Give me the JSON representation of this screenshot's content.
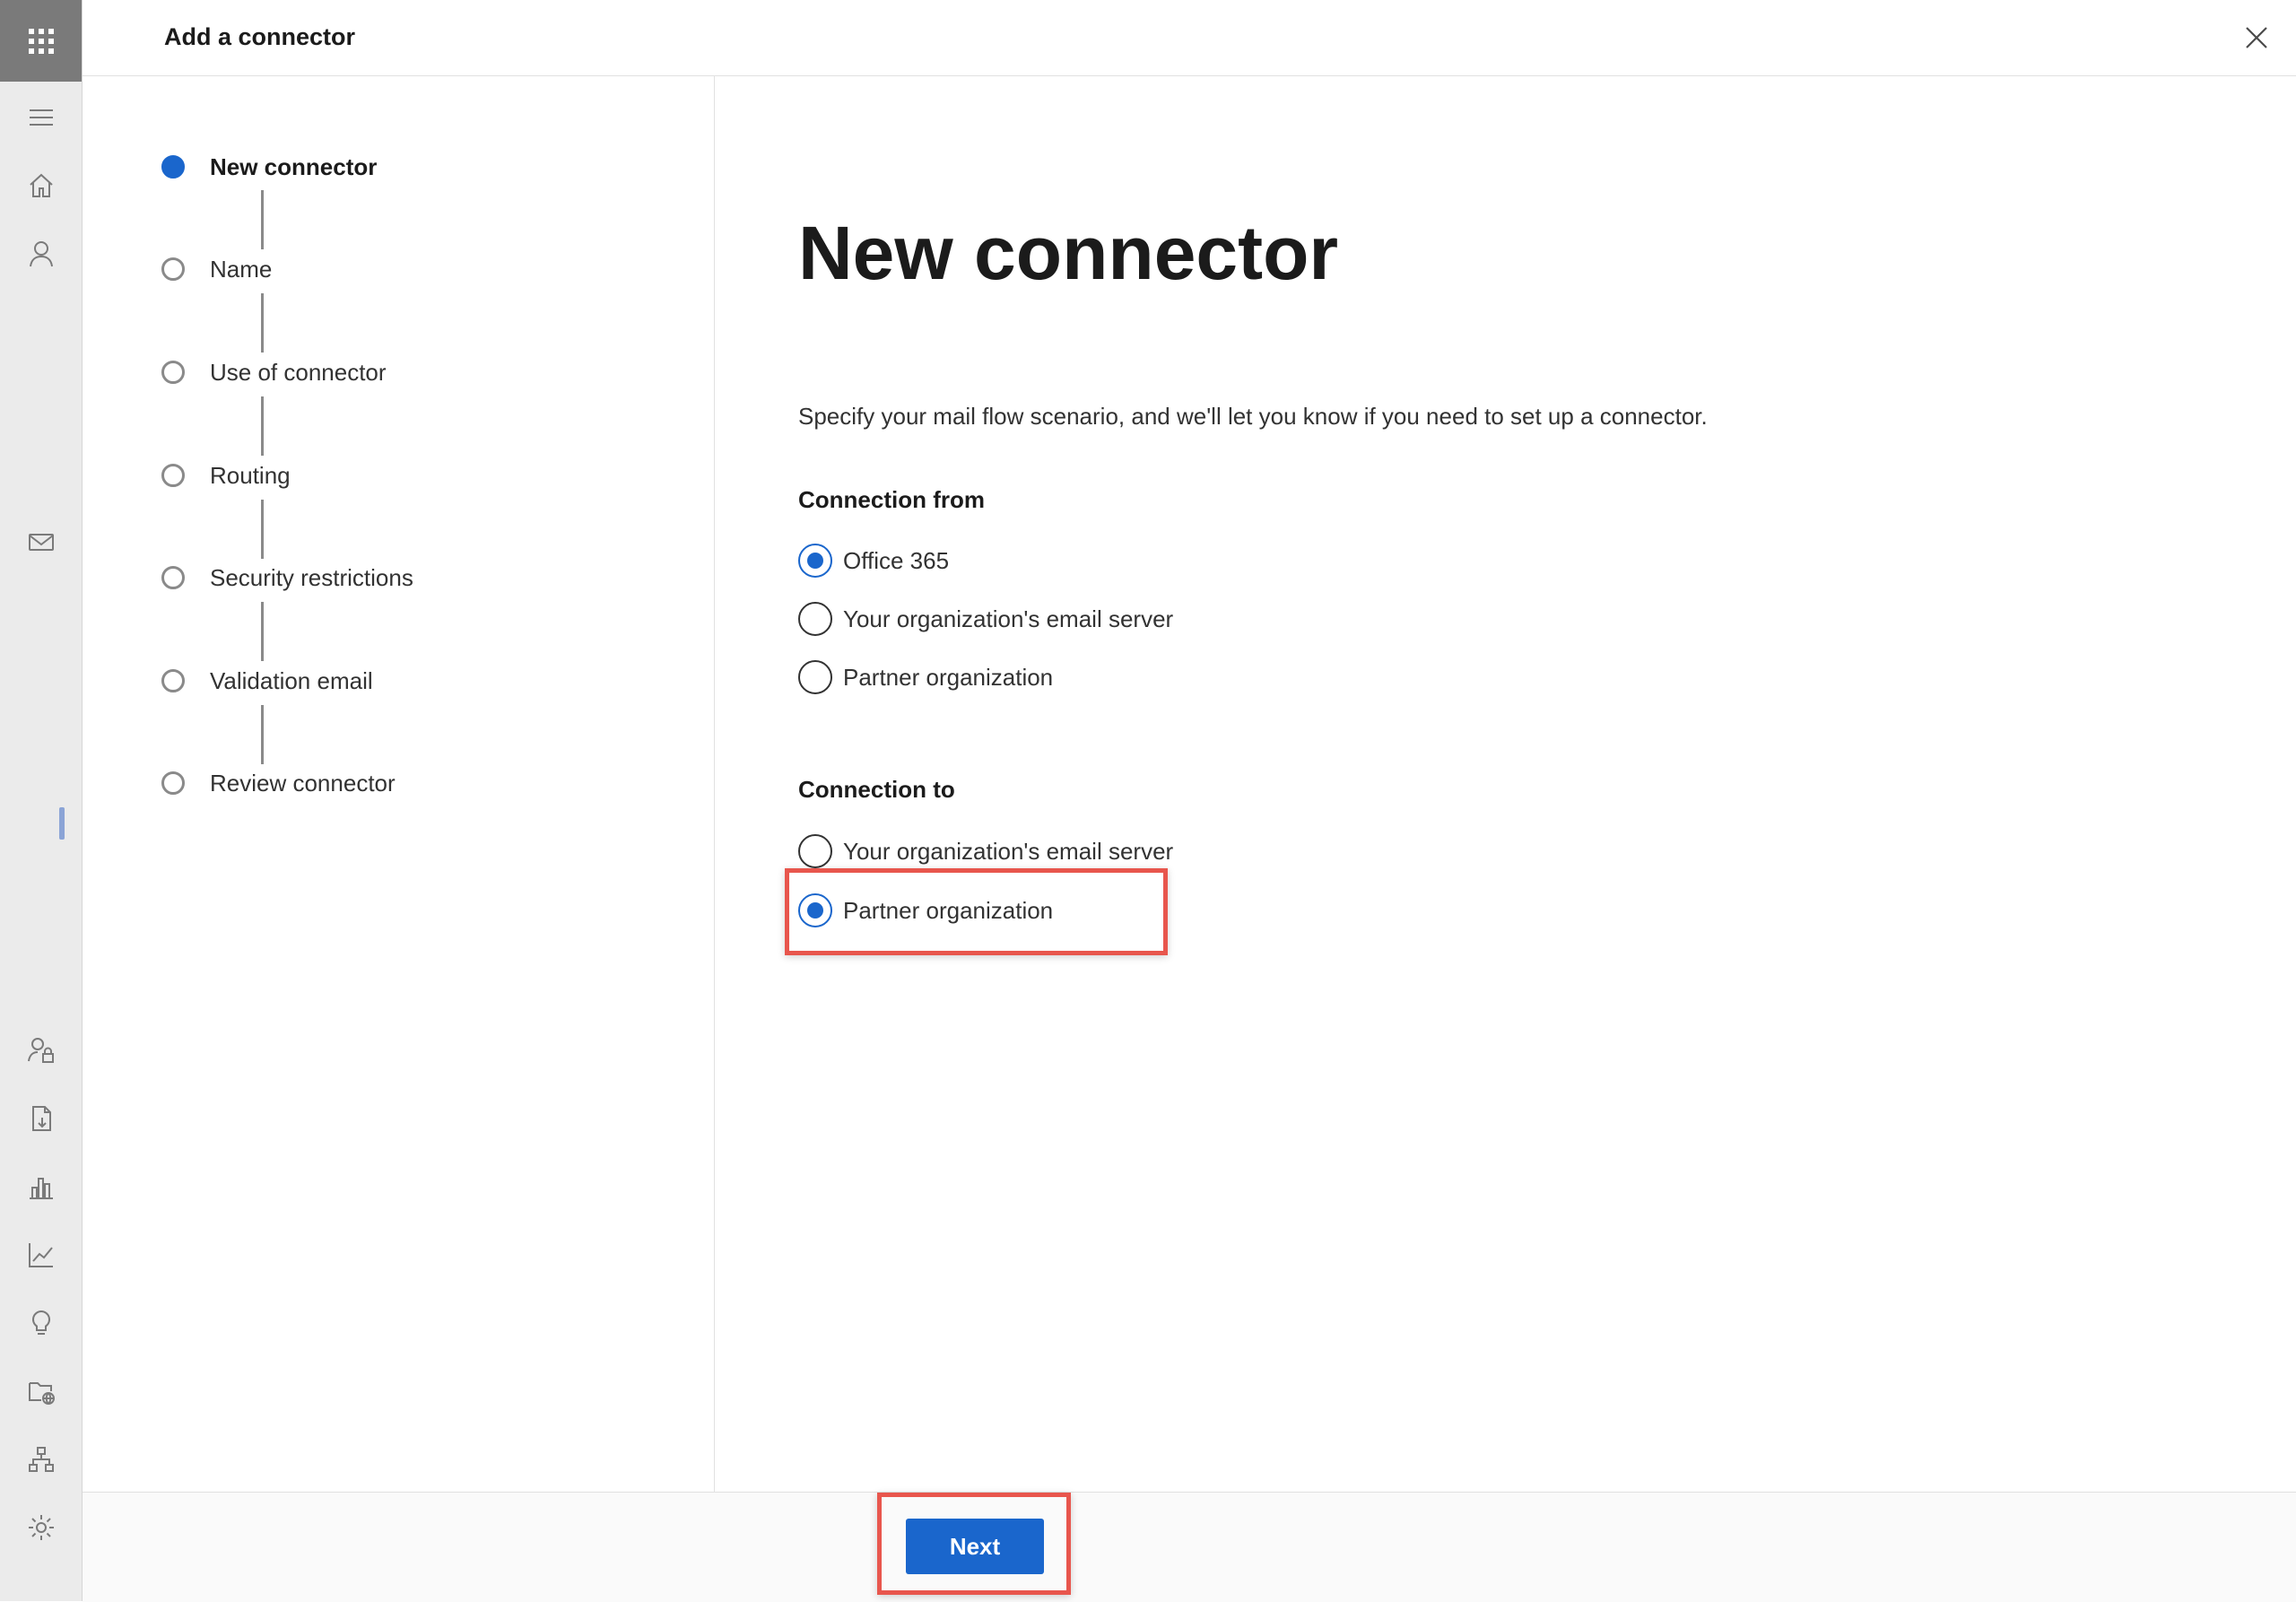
{
  "header": {
    "title": "Add a connector"
  },
  "steps": [
    {
      "label": "New connector",
      "state": "current"
    },
    {
      "label": "Name",
      "state": "pending"
    },
    {
      "label": "Use of connector",
      "state": "pending"
    },
    {
      "label": "Routing",
      "state": "pending"
    },
    {
      "label": "Security restrictions",
      "state": "pending"
    },
    {
      "label": "Validation email",
      "state": "pending"
    },
    {
      "label": "Review connector",
      "state": "pending"
    }
  ],
  "main": {
    "title": "New connector",
    "description": "Specify your mail flow scenario, and we'll let you know if you need to set up a connector.",
    "connection_from": {
      "label": "Connection from",
      "options": [
        "Office 365",
        "Your organization's email server",
        "Partner organization"
      ],
      "selected": "Office 365"
    },
    "connection_to": {
      "label": "Connection to",
      "options": [
        "Your organization's email server",
        "Partner organization"
      ],
      "selected": "Partner organization"
    }
  },
  "footer": {
    "next_label": "Next"
  },
  "nav_rail": {
    "icons": [
      "app-launcher-icon",
      "menu-icon",
      "home-icon",
      "person-icon",
      "mail-icon",
      "user-lock-icon",
      "document-icon",
      "reports-icon",
      "line-chart-icon",
      "lightbulb-icon",
      "folder-globe-icon",
      "org-chart-icon",
      "settings-icon"
    ]
  },
  "colors": {
    "accent": "#1a66cc",
    "highlight": "#e8564d",
    "rail": "#ebebeb"
  }
}
